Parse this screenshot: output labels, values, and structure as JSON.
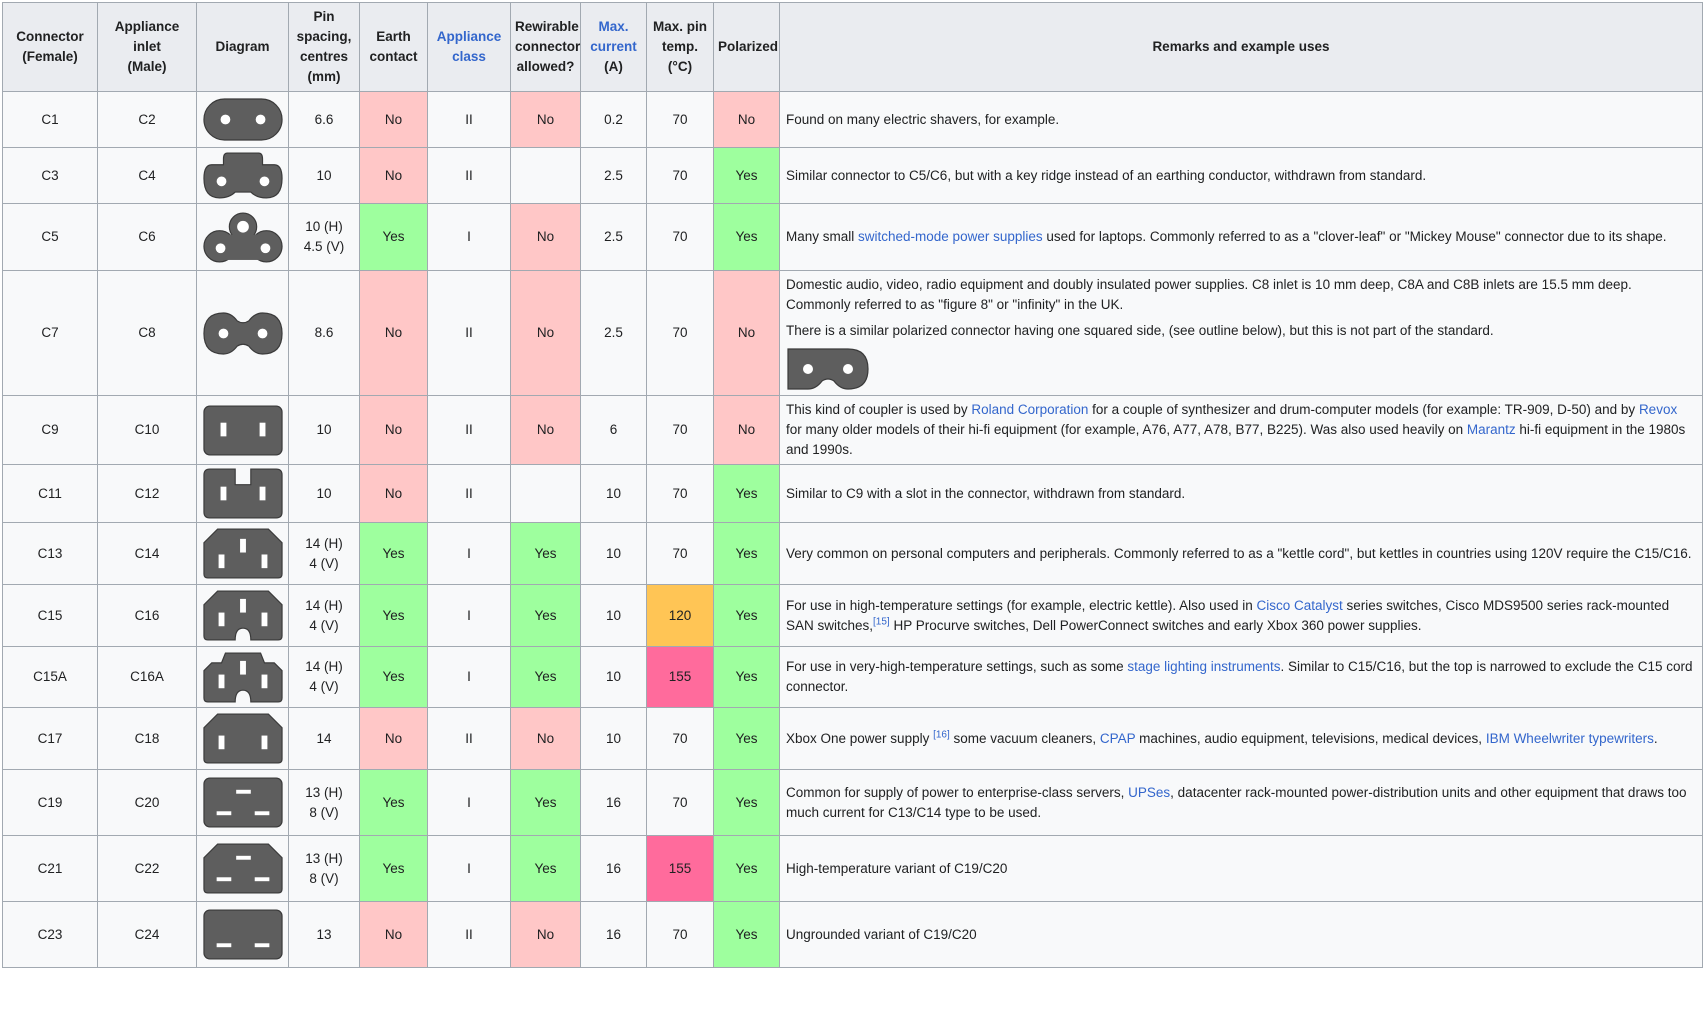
{
  "headers": [
    "Connector (Female)",
    "Appliance inlet (Male)",
    "Diagram",
    "Pin spacing, centres (mm)",
    "Earth contact",
    "Appliance class",
    "Rewirable connector allowed?",
    "Max. current (A)",
    "Max. pin temp. (°C)",
    "Polarized",
    "Remarks and example uses"
  ],
  "header_lines": {
    "h0": [
      "Connector",
      "(Female)"
    ],
    "h1": [
      "Appliance inlet",
      "(Male)"
    ],
    "h3": [
      "Pin",
      "spacing,",
      "centres",
      "(mm)"
    ],
    "h4": [
      "Earth",
      "contact"
    ],
    "h5": [
      "Appliance",
      "class"
    ],
    "h6": [
      "Rewirable",
      "connector",
      "allowed?"
    ],
    "h7a": "Max.",
    "h7b": "current",
    "h7c": "(A)",
    "h8": [
      "Max. pin",
      "temp.",
      "(°C)"
    ]
  },
  "colors": {
    "no": "#ffc7c7",
    "yes": "#9eff9e",
    "temp120": "#ffc555",
    "temp155": "#ff6b9c",
    "link": "#3366cc"
  },
  "rows": [
    {
      "female": "C1",
      "male": "C2",
      "icon": "shaver-connector-icon",
      "pin": [
        "6.6"
      ],
      "earth": "No",
      "cls": "II",
      "rewire": "No",
      "current": "0.2",
      "temp": "70",
      "polar": "No",
      "remark": [
        {
          "t": "Found on many electric shavers, for example."
        }
      ]
    },
    {
      "female": "C3",
      "male": "C4",
      "icon": "keyed-two-pin-connector-icon",
      "pin": [
        "10"
      ],
      "earth": "No",
      "cls": "II",
      "rewire": "",
      "current": "2.5",
      "temp": "70",
      "polar": "Yes",
      "remark": [
        {
          "t": "Similar connector to C5/C6, but with a key ridge instead of an earthing conductor, withdrawn from standard."
        }
      ]
    },
    {
      "female": "C5",
      "male": "C6",
      "icon": "clover-leaf-connector-icon",
      "pin": [
        "10 (H)",
        "4.5 (V)"
      ],
      "earth": "Yes",
      "cls": "I",
      "rewire": "No",
      "current": "2.5",
      "temp": "70",
      "polar": "Yes",
      "remark": [
        {
          "t": "Many small "
        },
        {
          "t": "switched-mode power supplies",
          "link": true
        },
        {
          "t": " used for laptops. Commonly referred to as a \"clover-leaf\" or \"Mickey Mouse\" connector due to its shape."
        }
      ]
    },
    {
      "female": "C7",
      "male": "C8",
      "icon": "figure-8-connector-icon",
      "pin": [
        "8.6"
      ],
      "earth": "No",
      "cls": "II",
      "rewire": "No",
      "current": "2.5",
      "temp": "70",
      "polar": "No",
      "remark_p1": "Domestic audio, video, radio equipment and doubly insulated power supplies. C8 inlet is 10 mm deep, C8A and C8B inlets are 15.5 mm deep. Commonly referred to as \"figure 8\" or \"infinity\" in the UK.",
      "remark_p2": "There is a similar polarized connector having one squared side, (see outline below), but this is not part of the standard."
    },
    {
      "female": "C9",
      "male": "C10",
      "icon": "rectangular-two-pin-connector-icon",
      "pin": [
        "10"
      ],
      "earth": "No",
      "cls": "II",
      "rewire": "No",
      "current": "6",
      "temp": "70",
      "polar": "No",
      "remark": [
        {
          "t": "This kind of coupler is used by "
        },
        {
          "t": "Roland Corporation",
          "link": true
        },
        {
          "t": " for a couple of synthesizer and drum-computer models (for example: TR-909, D-50) and by "
        },
        {
          "t": "Revox",
          "link": true
        },
        {
          "t": " for many older models of their hi-fi equipment (for example, A76, A77, A78, B77, B225). Was also used heavily on "
        },
        {
          "t": "Marantz",
          "link": true
        },
        {
          "t": " hi-fi equipment in the 1980s and 1990s."
        }
      ]
    },
    {
      "female": "C11",
      "male": "C12",
      "icon": "slotted-two-pin-connector-icon",
      "pin": [
        "10"
      ],
      "earth": "No",
      "cls": "II",
      "rewire": "",
      "current": "10",
      "temp": "70",
      "polar": "Yes",
      "remark": [
        {
          "t": "Similar to C9 with a slot in the connector, withdrawn from standard."
        }
      ]
    },
    {
      "female": "C13",
      "male": "C14",
      "icon": "kettle-cord-connector-icon",
      "pin": [
        "14 (H)",
        "4 (V)"
      ],
      "earth": "Yes",
      "cls": "I",
      "rewire": "Yes",
      "current": "10",
      "temp": "70",
      "polar": "Yes",
      "remark": [
        {
          "t": "Very common on personal computers and peripherals. Commonly referred to as a \"kettle cord\", but kettles in countries using 120V require the C15/C16."
        }
      ]
    },
    {
      "female": "C15",
      "male": "C16",
      "icon": "high-temp-connector-icon",
      "pin": [
        "14 (H)",
        "4 (V)"
      ],
      "earth": "Yes",
      "cls": "I",
      "rewire": "Yes",
      "current": "10",
      "temp": "120",
      "polar": "Yes",
      "remark": [
        {
          "t": "For use in high-temperature settings (for example, electric kettle). Also used in "
        },
        {
          "t": "Cisco Catalyst",
          "link": true
        },
        {
          "t": " series switches, Cisco MDS9500 series rack-mounted SAN switches,"
        },
        {
          "t": "[15]",
          "sup": true
        },
        {
          "t": " HP Procurve switches, Dell PowerConnect switches and early Xbox 360 power supplies."
        }
      ]
    },
    {
      "female": "C15A",
      "male": "C16A",
      "icon": "very-high-temp-connector-icon",
      "pin": [
        "14 (H)",
        "4 (V)"
      ],
      "earth": "Yes",
      "cls": "I",
      "rewire": "Yes",
      "current": "10",
      "temp": "155",
      "polar": "Yes",
      "remark": [
        {
          "t": "For use in very-high-temperature settings, such as some "
        },
        {
          "t": "stage lighting instruments",
          "link": true
        },
        {
          "t": ". Similar to C15/C16, but the top is narrowed to exclude the C15 cord connector."
        }
      ]
    },
    {
      "female": "C17",
      "male": "C18",
      "icon": "ungrounded-kettle-connector-icon",
      "pin": [
        "14"
      ],
      "earth": "No",
      "cls": "II",
      "rewire": "No",
      "current": "10",
      "temp": "70",
      "polar": "Yes",
      "remark": [
        {
          "t": "Xbox One power supply "
        },
        {
          "t": "[16]",
          "sup": true
        },
        {
          "t": " some vacuum cleaners, "
        },
        {
          "t": "CPAP",
          "link": true
        },
        {
          "t": " machines, audio equipment, televisions, medical devices, "
        },
        {
          "t": "IBM Wheelwriter typewriters",
          "link": true
        },
        {
          "t": "."
        }
      ]
    },
    {
      "female": "C19",
      "male": "C20",
      "icon": "c19-connector-icon",
      "pin": [
        "13 (H)",
        "8 (V)"
      ],
      "earth": "Yes",
      "cls": "I",
      "rewire": "Yes",
      "current": "16",
      "temp": "70",
      "polar": "Yes",
      "remark": [
        {
          "t": "Common for supply of power to enterprise-class servers, "
        },
        {
          "t": "UPSes",
          "link": true
        },
        {
          "t": ", datacenter rack-mounted power-distribution units and other equipment that draws too much current for C13/C14 type to be used."
        }
      ]
    },
    {
      "female": "C21",
      "male": "C22",
      "icon": "c21-connector-icon",
      "pin": [
        "13 (H)",
        "8 (V)"
      ],
      "earth": "Yes",
      "cls": "I",
      "rewire": "Yes",
      "current": "16",
      "temp": "155",
      "polar": "Yes",
      "remark": [
        {
          "t": "High-temperature variant of C19/C20"
        }
      ]
    },
    {
      "female": "C23",
      "male": "C24",
      "icon": "c23-connector-icon",
      "pin": [
        "13"
      ],
      "earth": "No",
      "cls": "II",
      "rewire": "No",
      "current": "16",
      "temp": "70",
      "polar": "Yes",
      "remark": [
        {
          "t": "Ungrounded variant of C19/C20"
        }
      ]
    }
  ]
}
